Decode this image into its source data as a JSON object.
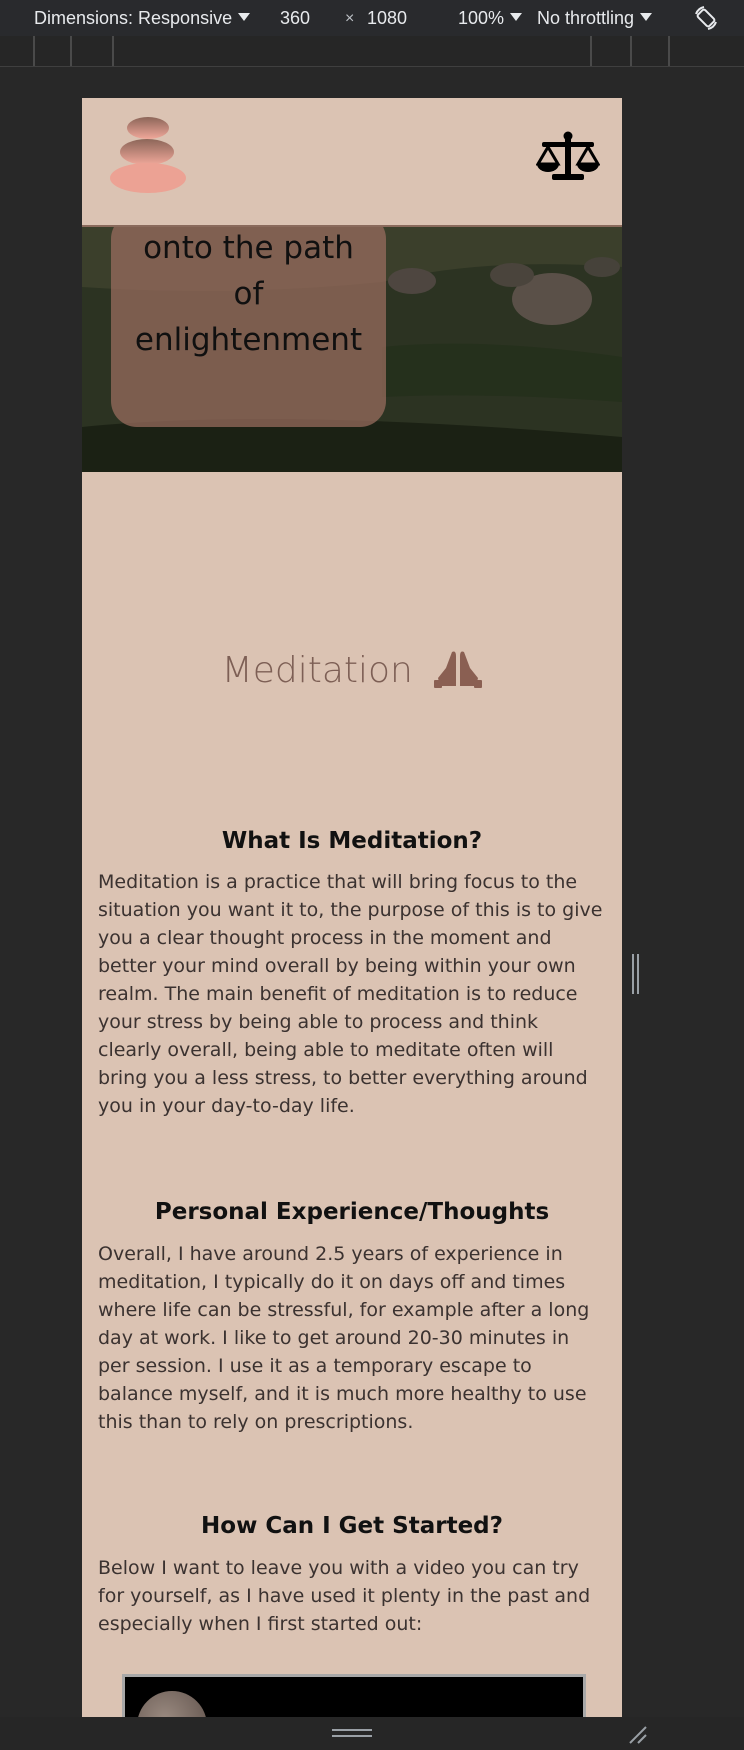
{
  "devtools": {
    "dimensions_label": "Dimensions: Responsive",
    "width_value": "360",
    "times_symbol": "×",
    "height_value": "1080",
    "zoom_label": "100%",
    "throttling_label": "No throttling",
    "rotate_icon": "rotate-icon"
  },
  "site": {
    "logo_icon": "stacked-stones-icon",
    "nav_icon": "balance-scale-icon",
    "hero": {
      "lines": [
        "onto the path",
        "of",
        "enlightenment"
      ]
    },
    "page_title": "Meditation",
    "page_title_icon": "praying-hands-icon",
    "sections": [
      {
        "heading": "What Is Meditation?",
        "text": "Meditation is a practice that will bring focus to the situation you want it to, the purpose of this is to give you a clear thought process in the moment and better your mind overall by being within your own realm. The main benefit of meditation is to reduce your stress by being able to process and think clearly overall, being able to meditate often will bring you a less stress, to better everything around you in your day-to-day life."
      },
      {
        "heading": "Personal Experience/Thoughts",
        "text": "Overall, I have around 2.5 years of experience in meditation, I typically do it on days off and times where life can be stressful, for example after a long day at work. I like to get around 20-30 minutes in per session. I use it as a temporary escape to balance myself, and it is much more healthy to use this than to rely on prescriptions."
      },
      {
        "heading": "How Can I Get Started?",
        "text": "Below I want to leave you with a video you can try for yourself, as I have used it plenty in the past and especially when I first started out:"
      }
    ]
  },
  "colors": {
    "page_bg": "#dbc3b3",
    "heading_brown": "#7d5f55",
    "hero_card": "#9b6e5f",
    "devtools_bg": "#292a2d"
  }
}
